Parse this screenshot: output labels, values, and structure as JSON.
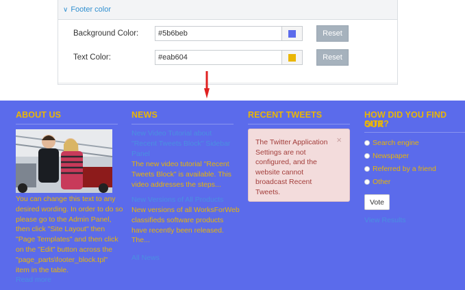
{
  "settings": {
    "section_title": "Footer color",
    "rows": [
      {
        "label": "Background Color:",
        "value": "#5b6beb",
        "swatch": "#5b6beb",
        "reset_label": "Reset"
      },
      {
        "label": "Text Color:",
        "value": "#eab604",
        "swatch": "#eab604",
        "reset_label": "Reset"
      }
    ]
  },
  "footer": {
    "background": "#5b6beb",
    "text_color": "#eab604",
    "link_color": "#4a8fe0",
    "about": {
      "title": "ABOUT US",
      "lines": [
        "You can change this text to any",
        "desired wording. In order to do so",
        "please go to the Admin Panel,",
        "then click \"Site Layout\" then",
        "\"Page Templates\" and then click",
        "on the \"Edit\" button across the",
        "\"page_parts\\footer_block.tpl\"",
        "item in the table."
      ],
      "more_link": "Read more"
    },
    "news": {
      "title": "NEWS",
      "items": [
        {
          "headline_lines": [
            "New Video Tutorial about",
            "\"Recent Tweets Block\" Sidebar",
            "Panel"
          ],
          "body_lines": [
            "The new video tutorial \"Recent",
            "Tweets Block\" is available. This",
            "video addresses the steps..."
          ]
        },
        {
          "headline_lines": [
            "New Versions of All Products"
          ],
          "body_lines": [
            "New versions of all WorksForWeb",
            "classifieds software products",
            "have recently been released.",
            "The..."
          ]
        }
      ],
      "all_link": "All News"
    },
    "tweets": {
      "title": "RECENT TWEETS",
      "message_lines": [
        "The Twitter Application",
        "Settings are not",
        "configured, and the",
        "website cannot",
        "broadcast Recent",
        "Tweets."
      ],
      "close_glyph": "×"
    },
    "poll": {
      "title_lines": [
        "HOW DID YOU FIND OUR",
        "SITE?"
      ],
      "options": [
        "Search engine",
        "Newspaper",
        "Referred by a friend",
        "Other"
      ],
      "vote_label": "Vote",
      "results_link": "View Results"
    }
  }
}
